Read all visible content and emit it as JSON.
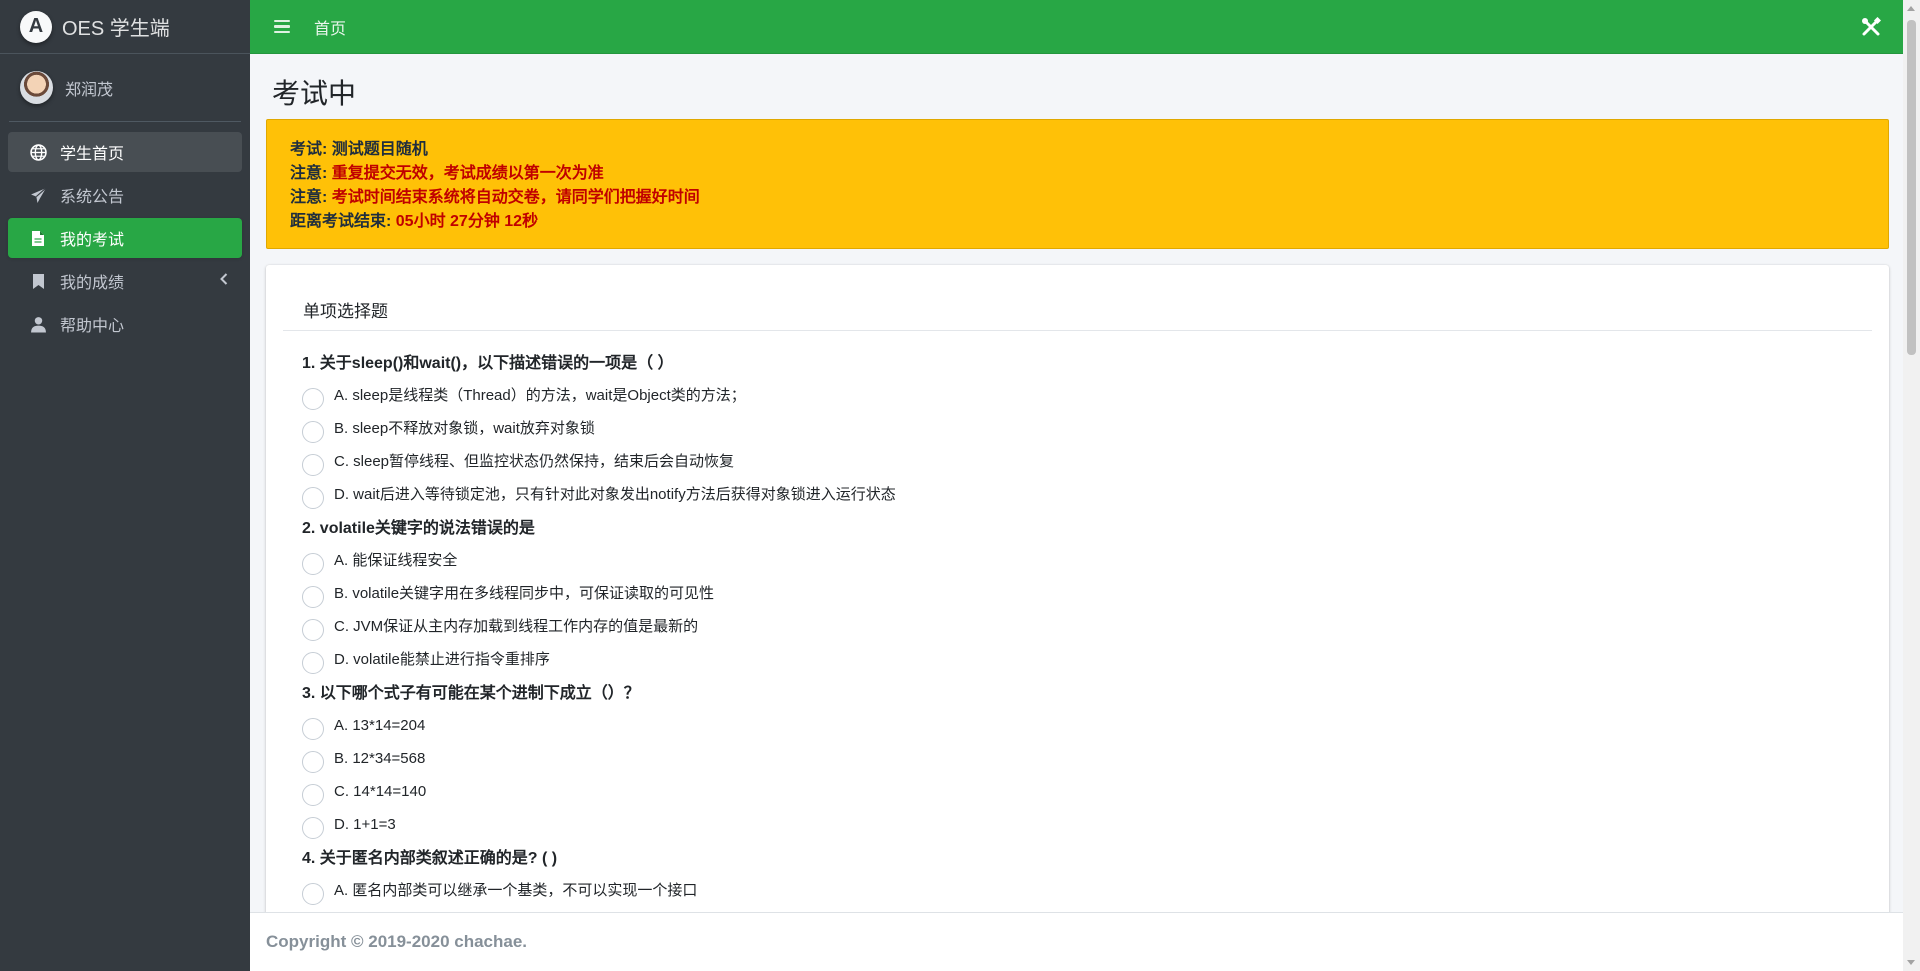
{
  "brand": {
    "logo_letter": "A",
    "title": "OES 学生端"
  },
  "user": {
    "name": "郑润茂"
  },
  "sidebar": {
    "items": [
      {
        "label": "学生首页",
        "icon": "globe-icon",
        "state": "hover"
      },
      {
        "label": "系统公告",
        "icon": "paper-plane-icon",
        "state": ""
      },
      {
        "label": "我的考试",
        "icon": "file-icon",
        "state": "active"
      },
      {
        "label": "我的成绩",
        "icon": "bookmark-icon",
        "state": "",
        "has_arrow": true
      },
      {
        "label": "帮助中心",
        "icon": "user-icon",
        "state": ""
      }
    ]
  },
  "topbar": {
    "menu_icon": "bars-icon",
    "home_link": "首页",
    "tools_icon": "tools-icon"
  },
  "page": {
    "title": "考试中"
  },
  "alert": {
    "exam_label": "考试: ",
    "exam_name": "测试题目随机",
    "note1_label": "注意: ",
    "note1_text": "重复提交无效，考试成绩以第一次为准",
    "note2_label": "注意: ",
    "note2_text": "考试时间结束系统将自动交卷，请同学们把握好时间",
    "countdown_label": "距离考试结束: ",
    "countdown_value": "05小时 27分钟 12秒"
  },
  "card": {
    "section_title": "单项选择题"
  },
  "questions": [
    {
      "title": "1. 关于sleep()和wait()，以下描述错误的一项是（ ）",
      "options": [
        "A. sleep是线程类（Thread）的方法，wait是Object类的方法；",
        "B. sleep不释放对象锁，wait放弃对象锁",
        "C. sleep暂停线程、但监控状态仍然保持，结束后会自动恢复",
        "D. wait后进入等待锁定池，只有针对此对象发出notify方法后获得对象锁进入运行状态"
      ]
    },
    {
      "title": "2. volatile关键字的说法错误的是",
      "options": [
        "A. 能保证线程安全",
        "B. volatile关键字用在多线程同步中，可保证读取的可见性",
        "C. JVM保证从主内存加载到线程工作内存的值是最新的",
        "D. volatile能禁止进行指令重排序"
      ]
    },
    {
      "title": "3. 以下哪个式子有可能在某个进制下成立（）？",
      "options": [
        "A. 13*14=204",
        "B. 12*34=568",
        "C. 14*14=140",
        "D. 1+1=3"
      ]
    },
    {
      "title": "4. 关于匿名内部类叙述正确的是? ( )",
      "options": [
        "A. 匿名内部类可以继承一个基类，不可以实现一个接口"
      ]
    }
  ],
  "footer": {
    "copyright": "Copyright © 2019-2020 chachae."
  }
}
